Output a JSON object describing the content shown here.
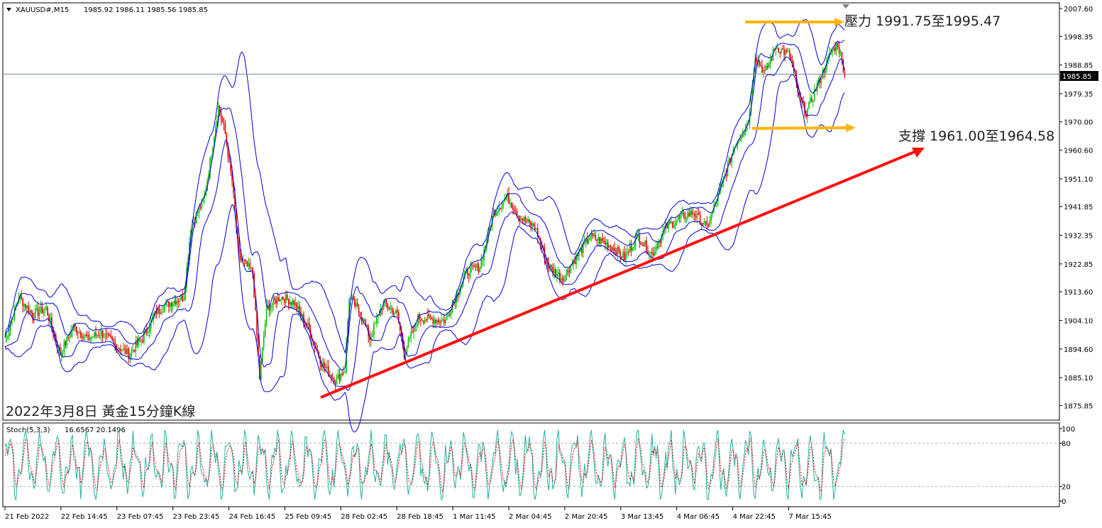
{
  "header": {
    "symbol": "XAUUSD#,M15",
    "ohlc": "1985.92 1986.11 1985.56 1985.85"
  },
  "chart_data": {
    "type": "candlestick",
    "title": "2022年3月8日 黃金15分鐘K線",
    "price_axis": {
      "range": [
        1871.0,
        2009.5
      ],
      "ticks": [
        "2007.60",
        "1998.35",
        "1988.85",
        "1979.35",
        "1970.00",
        "1960.60",
        "1951.10",
        "1941.85",
        "1932.35",
        "1922.85",
        "1913.60",
        "1904.10",
        "1894.60",
        "1885.10",
        "1875.85"
      ],
      "current_price": "1985.85"
    },
    "time_axis": {
      "labels": [
        "21 Feb 2022",
        "22 Feb 14:45",
        "23 Feb 07:45",
        "23 Feb 23:45",
        "24 Feb 16:45",
        "25 Feb 09:45",
        "28 Feb 02:45",
        "28 Feb 18:45",
        "1 Mar 11:45",
        "2 Mar 04:45",
        "2 Mar 20:45",
        "3 Mar 13:45",
        "4 Mar 06:45",
        "4 Mar 22:45",
        "7 Mar 15:45"
      ]
    },
    "price_path": [
      {
        "bar": 0,
        "price": 1897
      },
      {
        "bar": 10,
        "price": 1912
      },
      {
        "bar": 20,
        "price": 1906
      },
      {
        "bar": 30,
        "price": 1908
      },
      {
        "bar": 40,
        "price": 1893
      },
      {
        "bar": 50,
        "price": 1902
      },
      {
        "bar": 60,
        "price": 1898
      },
      {
        "bar": 70,
        "price": 1900
      },
      {
        "bar": 80,
        "price": 1896
      },
      {
        "bar": 90,
        "price": 1893
      },
      {
        "bar": 100,
        "price": 1898
      },
      {
        "bar": 110,
        "price": 1907
      },
      {
        "bar": 120,
        "price": 1910
      },
      {
        "bar": 130,
        "price": 1912
      },
      {
        "bar": 135,
        "price": 1935
      },
      {
        "bar": 145,
        "price": 1945
      },
      {
        "bar": 150,
        "price": 1960
      },
      {
        "bar": 155,
        "price": 1975
      },
      {
        "bar": 160,
        "price": 1966
      },
      {
        "bar": 165,
        "price": 1950
      },
      {
        "bar": 170,
        "price": 1925
      },
      {
        "bar": 180,
        "price": 1920
      },
      {
        "bar": 185,
        "price": 1885
      },
      {
        "bar": 190,
        "price": 1908
      },
      {
        "bar": 200,
        "price": 1912
      },
      {
        "bar": 210,
        "price": 1910
      },
      {
        "bar": 220,
        "price": 1902
      },
      {
        "bar": 230,
        "price": 1890
      },
      {
        "bar": 240,
        "price": 1884
      },
      {
        "bar": 247,
        "price": 1888
      },
      {
        "bar": 250,
        "price": 1912
      },
      {
        "bar": 260,
        "price": 1905
      },
      {
        "bar": 265,
        "price": 1898
      },
      {
        "bar": 275,
        "price": 1910
      },
      {
        "bar": 285,
        "price": 1906
      },
      {
        "bar": 290,
        "price": 1893
      },
      {
        "bar": 300,
        "price": 1905
      },
      {
        "bar": 320,
        "price": 1904
      },
      {
        "bar": 335,
        "price": 1920
      },
      {
        "bar": 345,
        "price": 1922
      },
      {
        "bar": 355,
        "price": 1940
      },
      {
        "bar": 365,
        "price": 1945
      },
      {
        "bar": 375,
        "price": 1938
      },
      {
        "bar": 385,
        "price": 1935
      },
      {
        "bar": 395,
        "price": 1922
      },
      {
        "bar": 405,
        "price": 1918
      },
      {
        "bar": 415,
        "price": 1925
      },
      {
        "bar": 425,
        "price": 1932
      },
      {
        "bar": 440,
        "price": 1929
      },
      {
        "bar": 450,
        "price": 1925
      },
      {
        "bar": 460,
        "price": 1932
      },
      {
        "bar": 470,
        "price": 1926
      },
      {
        "bar": 480,
        "price": 1935
      },
      {
        "bar": 490,
        "price": 1938
      },
      {
        "bar": 500,
        "price": 1940
      },
      {
        "bar": 510,
        "price": 1935
      },
      {
        "bar": 520,
        "price": 1948
      },
      {
        "bar": 530,
        "price": 1962
      },
      {
        "bar": 540,
        "price": 1970
      },
      {
        "bar": 545,
        "price": 1992
      },
      {
        "bar": 552,
        "price": 1986
      },
      {
        "bar": 560,
        "price": 1995
      },
      {
        "bar": 570,
        "price": 1992
      },
      {
        "bar": 577,
        "price": 1978
      },
      {
        "bar": 582,
        "price": 1973
      },
      {
        "bar": 590,
        "price": 1982
      },
      {
        "bar": 600,
        "price": 1993
      },
      {
        "bar": 605,
        "price": 1996
      },
      {
        "bar": 610,
        "price": 1986
      }
    ],
    "indicator": {
      "name": "Stoch(5,3,3)",
      "values_text": "16.6567 20.1496",
      "ticks": [
        "100",
        "80",
        "20",
        "0"
      ],
      "levels": [
        80,
        20
      ]
    },
    "annotations": {
      "resistance": "壓力 1991.75至1995.47",
      "support": "支撐 1961.00至1964.58"
    },
    "colors": {
      "bull_candle": "#00c000",
      "bear_candle": "#e00000",
      "bands": "#0000e0",
      "trendline": "#ff1010",
      "level_arrows": "#ffb400",
      "stoch_main": "#20b0a0",
      "stoch_signal": "#e00000"
    }
  }
}
